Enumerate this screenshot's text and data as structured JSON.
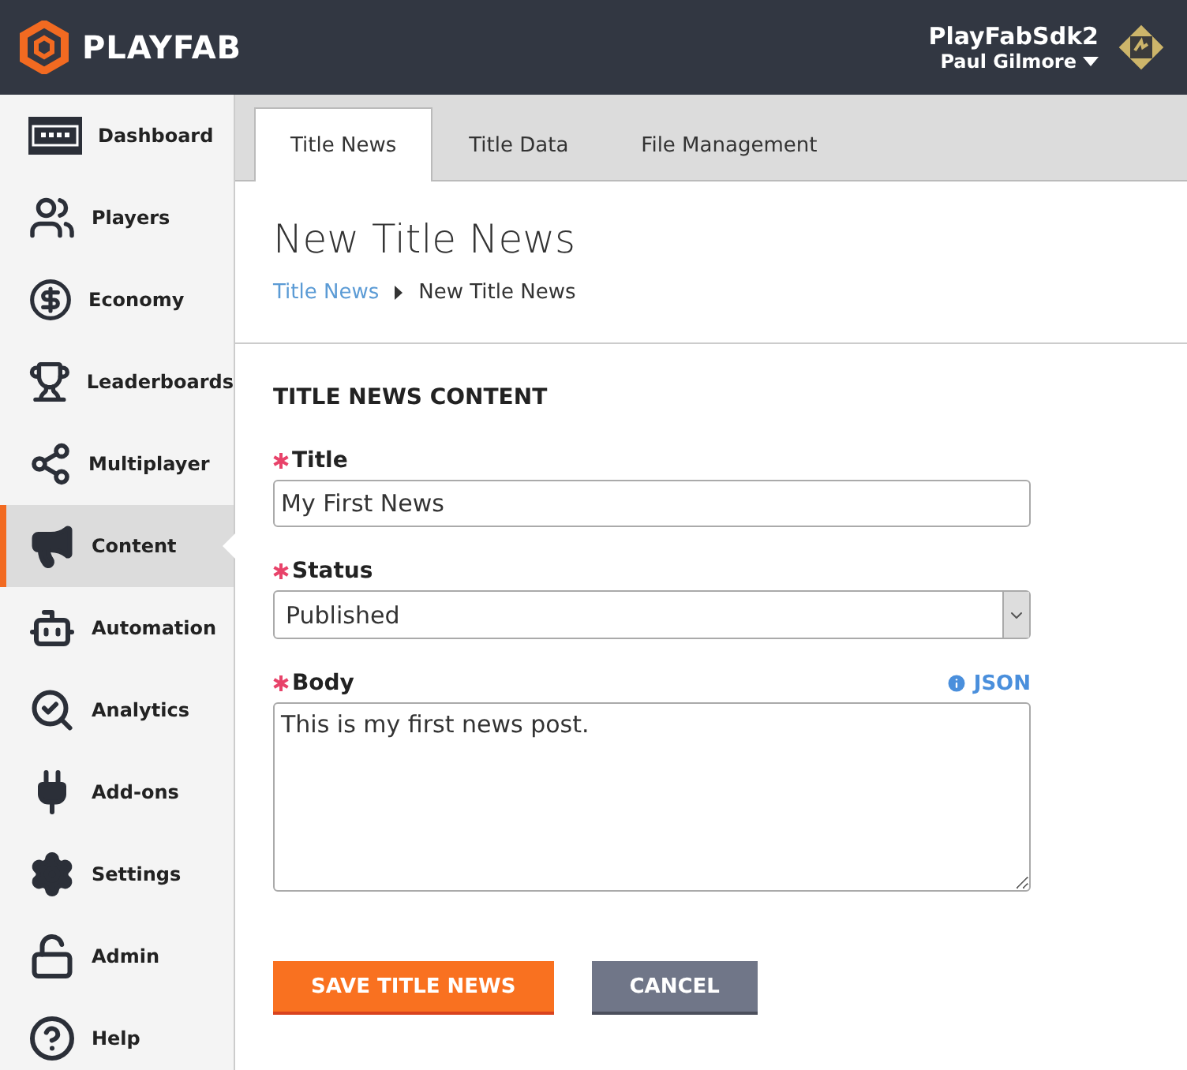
{
  "header": {
    "logo_text": "PLAYFAB",
    "title_name": "PlayFabSdk2",
    "user_name": "Paul Gilmore"
  },
  "sidebar": {
    "items": [
      {
        "label": "Dashboard",
        "selected": false
      },
      {
        "label": "Players",
        "selected": false
      },
      {
        "label": "Economy",
        "selected": false
      },
      {
        "label": "Leaderboards",
        "selected": false
      },
      {
        "label": "Multiplayer",
        "selected": false
      },
      {
        "label": "Content",
        "selected": true
      },
      {
        "label": "Automation",
        "selected": false
      },
      {
        "label": "Analytics",
        "selected": false
      },
      {
        "label": "Add-ons",
        "selected": false
      },
      {
        "label": "Settings",
        "selected": false
      },
      {
        "label": "Admin",
        "selected": false
      },
      {
        "label": "Help",
        "selected": false
      }
    ]
  },
  "tabs": [
    {
      "label": "Title News",
      "selected": true
    },
    {
      "label": "Title Data",
      "selected": false
    },
    {
      "label": "File Management",
      "selected": false
    }
  ],
  "page": {
    "title": "New Title News",
    "breadcrumb": [
      {
        "label": "Title News",
        "kind": "link"
      },
      {
        "label": "New Title News",
        "kind": "current"
      }
    ]
  },
  "form": {
    "section_title": "TITLE NEWS CONTENT",
    "fields": [
      {
        "kind": "text",
        "label": "Title",
        "required": true,
        "value": "My First News"
      },
      {
        "kind": "select",
        "label": "Status",
        "required": true,
        "value": "Published"
      },
      {
        "kind": "textarea",
        "label": "Body",
        "required": true,
        "value": "This is my first news post.",
        "link": "JSON"
      }
    ],
    "buttons": [
      {
        "label": "SAVE TITLE NEWS",
        "kind": "primary"
      },
      {
        "label": "CANCEL",
        "kind": "secondary"
      }
    ]
  }
}
